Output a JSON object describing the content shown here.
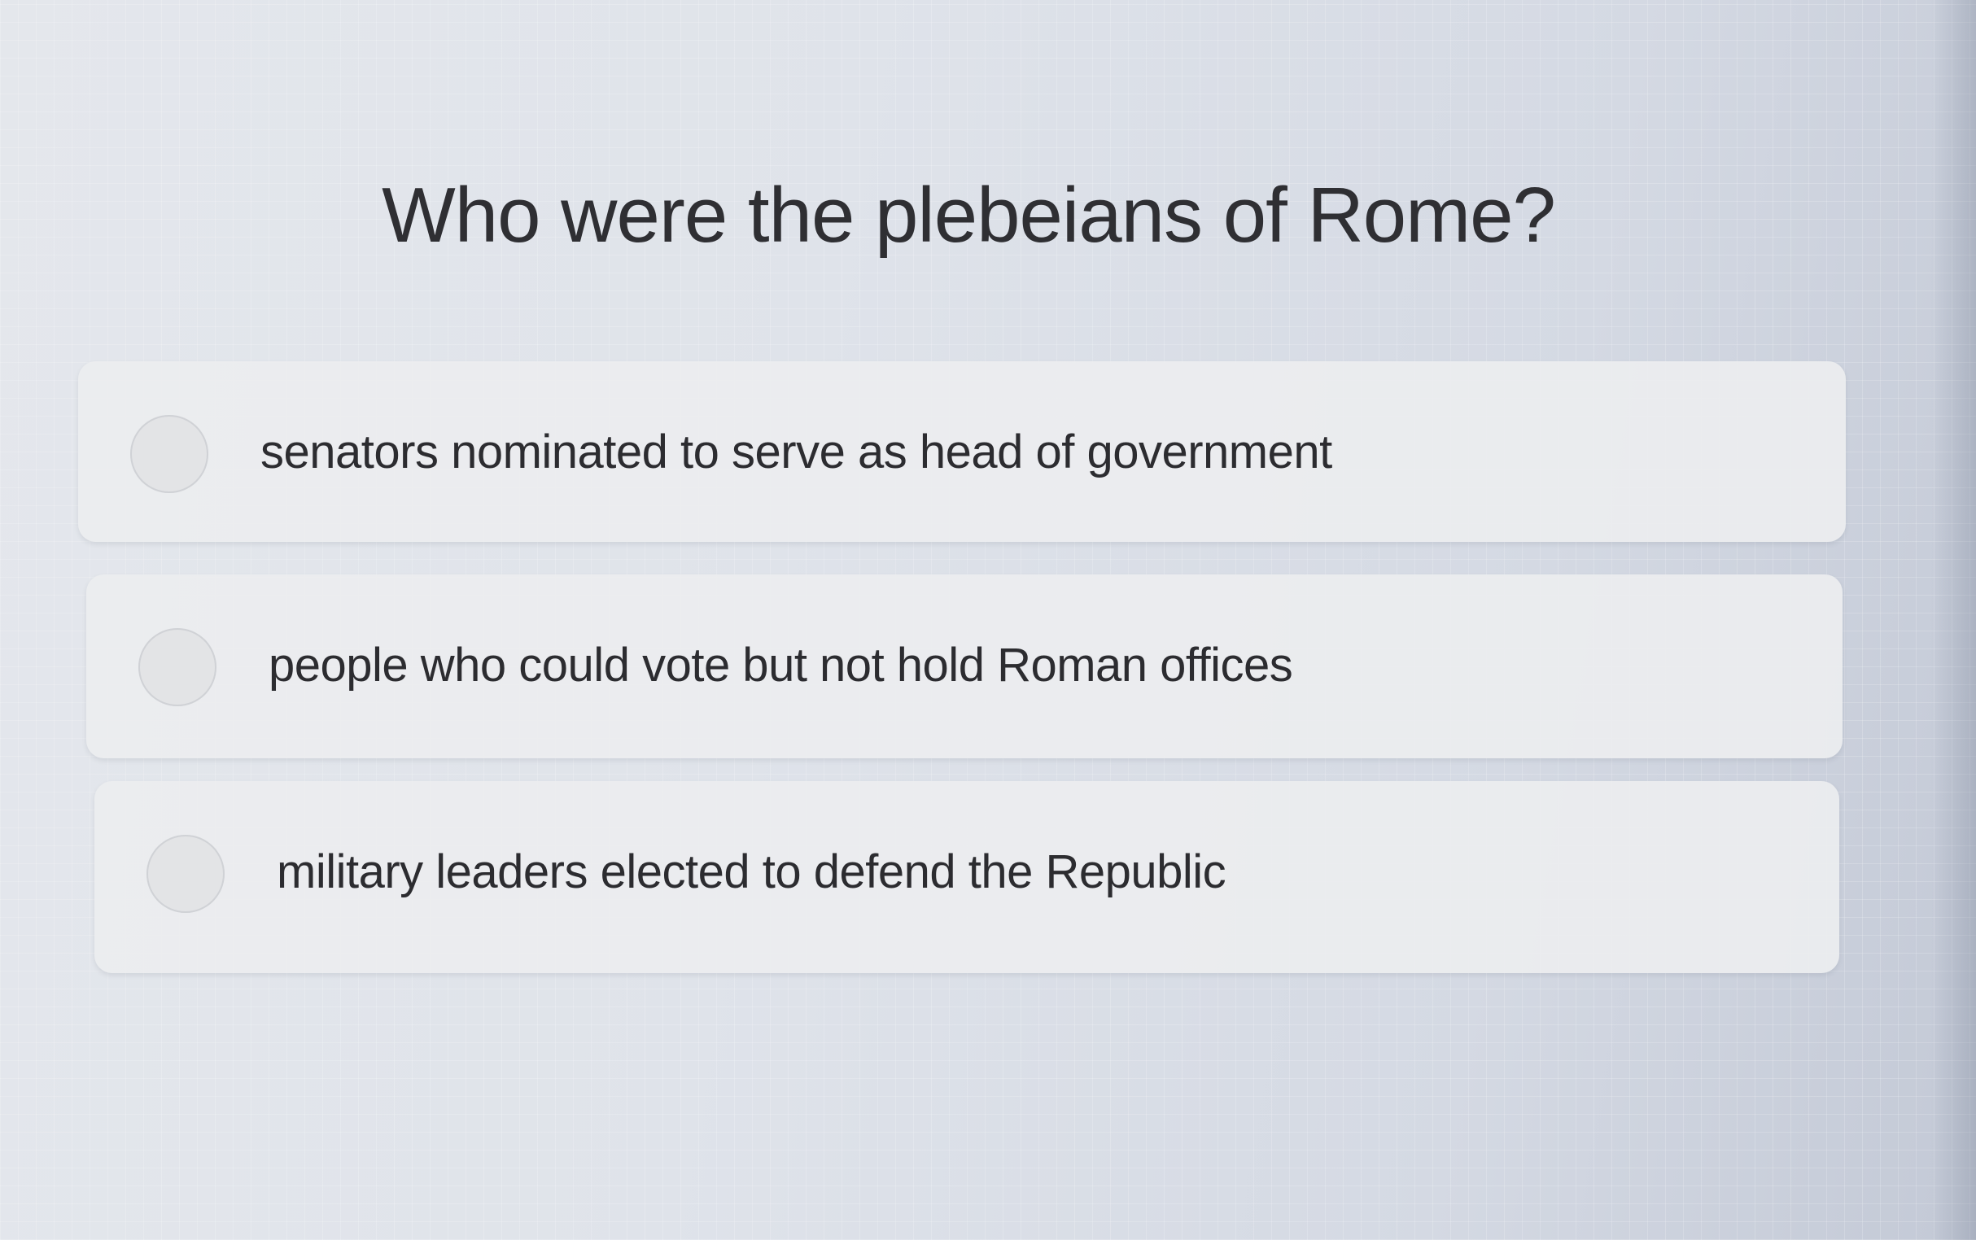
{
  "quiz": {
    "question": "Who were the plebeians of Rome?",
    "choices": [
      {
        "label": "senators nominated to serve as head of government",
        "selected": false
      },
      {
        "label": "people who could vote but not hold Roman offices",
        "selected": false
      },
      {
        "label": "military leaders elected to defend the Republic",
        "selected": false
      }
    ]
  },
  "colors": {
    "background": "#dfe3ea",
    "choice_card": "#ecedef",
    "text": "#2f2f33",
    "radio": "#e3e4e6"
  },
  "icons": {
    "choice_marker": "radio-button-icon"
  }
}
